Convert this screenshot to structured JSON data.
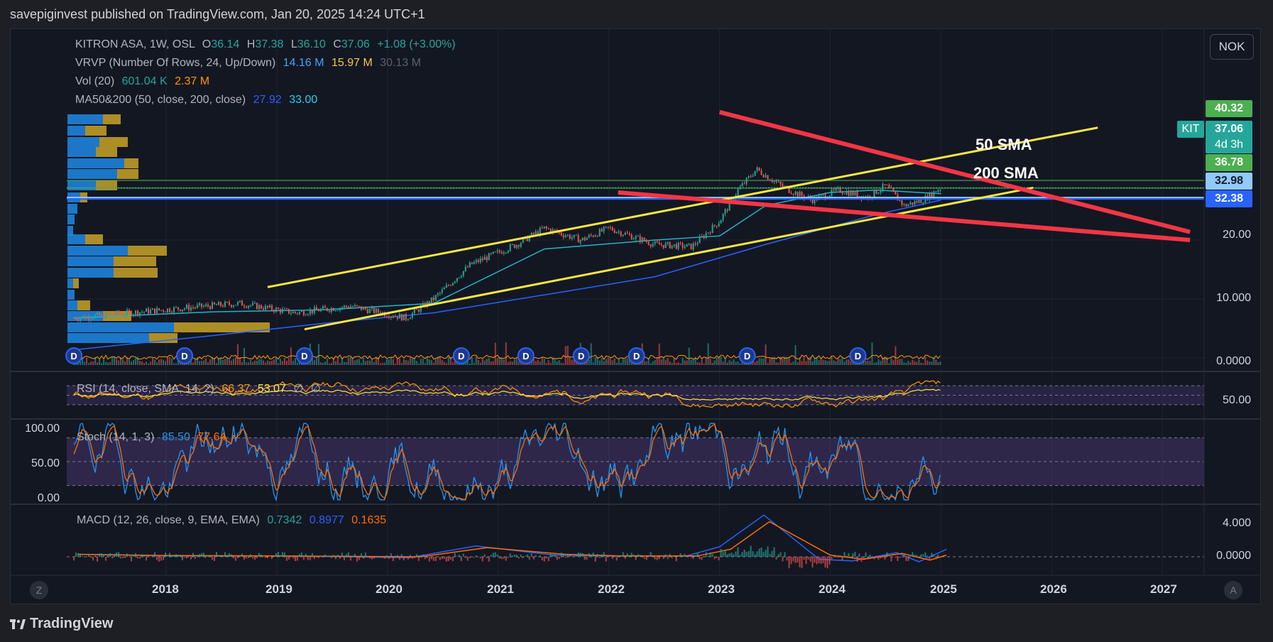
{
  "header": "savepiginvest published on TradingView.com, Jan 20, 2025 14:24 UTC+1",
  "currency_button": "NOK",
  "footer_brand": "TradingView",
  "legend": {
    "symbol": "KITRON ASA, 1W, OSL",
    "open_label": "O",
    "open": "36.14",
    "high_label": "H",
    "high": "37.38",
    "low_label": "L",
    "low": "36.10",
    "close_label": "C",
    "close": "37.06",
    "change": "+1.08 (+3.00%)",
    "vrvp_label": "VRVP (Number Of Rows, 24, Up/Down)",
    "vrvp_up": "14.16 M",
    "vrvp_down": "15.97 M",
    "vrvp_total": "30.13 M",
    "vol_label": "Vol (20)",
    "vol": "601.04 K",
    "vol_ma": "2.37 M",
    "ma_label": "MA50&200 (50, close, 200, close)",
    "ma50": "27.92",
    "ma200": "33.00"
  },
  "rsi_legend": {
    "label": "RSI (14, close, SMA, 14, 2)",
    "rsi": "66.37",
    "sma": "53.07",
    "x1": "∅",
    "x2": "∅"
  },
  "stoch_legend": {
    "label": "Stoch (14, 1, 3)",
    "k": "85.50",
    "d": "77.64"
  },
  "macd_legend": {
    "label": "MACD (12, 26, close, 9, EMA, EMA)",
    "hist": "0.7342",
    "macd": "0.8977",
    "signal": "0.1635"
  },
  "price_axis": [
    "20.00",
    "10.000",
    "0.0000"
  ],
  "rsi_axis": "50.00",
  "stoch_axis": [
    "100.00",
    "50.00",
    "0.00"
  ],
  "macd_axis": [
    "4.000",
    "0.0000"
  ],
  "time_axis": [
    "2018",
    "2019",
    "2020",
    "2021",
    "2022",
    "2023",
    "2024",
    "2025",
    "2026",
    "2027"
  ],
  "price_tags": {
    "p1": "40.32",
    "ticker": "KIT",
    "last": "37.06",
    "countdown": "4d 3h",
    "p2": "36.78",
    "p3": "32.98",
    "p4": "32.38"
  },
  "annotations": {
    "sma50": "50 SMA",
    "sma200": "200 SMA"
  },
  "dividend_marker": "D",
  "corner_left": "Z",
  "corner_right": "A",
  "colors": {
    "background": "#131722",
    "up": "#26a69a",
    "down": "#ef5350",
    "trendline_yellow": "#f6e645",
    "trendline_red": "#f23645",
    "ma50": "#22b5c6",
    "ma200": "#2962ff",
    "vrvp_up": "#1e88e5",
    "vrvp_down": "#c9a227",
    "rsi_band": "#7e57c2"
  },
  "chart_data": {
    "type": "candlestick",
    "title": "KITRON ASA, 1W, OSL",
    "xlabel": "",
    "ylabel": "",
    "x_range": [
      "2017-03",
      "2027-04"
    ],
    "price_scale": "log",
    "series": [
      {
        "name": "close (approx.)",
        "x": [
          "2017-03",
          "2017-09",
          "2018-03",
          "2018-09",
          "2019-03",
          "2019-09",
          "2020-03",
          "2020-06",
          "2020-10",
          "2021-03",
          "2021-06",
          "2021-10",
          "2022-01",
          "2022-06",
          "2022-10",
          "2023-01",
          "2023-03",
          "2023-05",
          "2023-08",
          "2023-11",
          "2024-02",
          "2024-05",
          "2024-07",
          "2024-09",
          "2024-11",
          "2025-01"
        ],
        "values": [
          8.0,
          8.5,
          9.0,
          9.5,
          8.5,
          9.2,
          8.0,
          10.0,
          15.0,
          19.0,
          23.0,
          20.0,
          23.0,
          19.0,
          18.5,
          25.0,
          36.0,
          46.0,
          37.0,
          32.0,
          36.0,
          33.0,
          38.0,
          30.0,
          32.0,
          37.06
        ]
      },
      {
        "name": "MA50",
        "x": [
          "2017-03",
          "2018-06",
          "2019-06",
          "2020-06",
          "2021-06",
          "2022-06",
          "2023-01",
          "2023-06",
          "2024-01",
          "2024-06",
          "2025-01"
        ],
        "values": [
          8.0,
          8.6,
          8.8,
          9.5,
          18.0,
          20.0,
          21.0,
          30.0,
          35.0,
          36.0,
          34.5
        ]
      },
      {
        "name": "MA200",
        "x": [
          "2017-03",
          "2018-06",
          "2019-06",
          "2020-06",
          "2021-06",
          "2022-06",
          "2023-06",
          "2024-06",
          "2025-01"
        ],
        "values": [
          5.5,
          6.5,
          7.5,
          8.5,
          10.5,
          13.0,
          19.0,
          27.0,
          32.0
        ]
      }
    ],
    "trendlines": [
      {
        "color": "yellow",
        "from": [
          "2018-12",
          11.5
        ],
        "to": [
          "2026-06",
          75.0
        ]
      },
      {
        "color": "yellow",
        "from": [
          "2019-04",
          7.0
        ],
        "to": [
          "2025-11",
          37.0
        ]
      },
      {
        "color": "red",
        "from": [
          "2023-01",
          90.0
        ],
        "to": [
          "2027-04",
          22.0
        ]
      },
      {
        "color": "red",
        "from": [
          "2022-02",
          35.0
        ],
        "to": [
          "2027-04",
          20.0
        ]
      }
    ],
    "horizontal_levels": [
      40.32,
      37.06,
      36.78,
      32.98,
      32.38
    ],
    "dividends_x": [
      "2017-03",
      "2018-03",
      "2019-04",
      "2020-09",
      "2021-04",
      "2021-10",
      "2022-04",
      "2023-04",
      "2024-04"
    ],
    "indicators": {
      "rsi": {
        "value": 66.37,
        "sma": 53.07,
        "band": [
          30,
          70
        ]
      },
      "stochastic": {
        "k": 85.5,
        "d": 77.64,
        "ylim": [
          0,
          100
        ],
        "band": [
          20,
          80
        ]
      },
      "macd": {
        "histogram": 0.7342,
        "macd": 0.8977,
        "signal": 0.1635,
        "peak_x": "2023-05",
        "peak": 5.0
      }
    }
  }
}
